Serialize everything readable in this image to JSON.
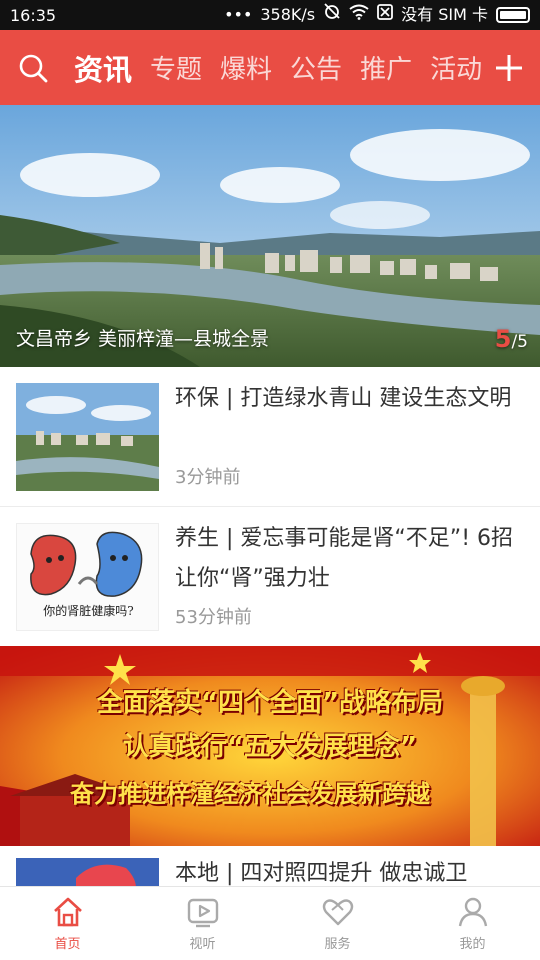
{
  "status_bar": {
    "time": "16:35",
    "dots": "•••",
    "speed": "358K/s",
    "sim": "没有 SIM 卡"
  },
  "nav": {
    "tabs": [
      {
        "label": "资讯",
        "active": true
      },
      {
        "label": "专题",
        "active": false
      },
      {
        "label": "爆料",
        "active": false
      },
      {
        "label": "公告",
        "active": false
      },
      {
        "label": "推广",
        "active": false
      },
      {
        "label": "活动",
        "active": false
      }
    ]
  },
  "hero": {
    "caption": "文昌帝乡 美丽梓潼—县城全景",
    "current_page": "5",
    "total_pages": "/5"
  },
  "news": [
    {
      "title": "环保 | 打造绿水青山 建设生态文明",
      "time": "3分钟前"
    },
    {
      "title": "养生 | 爱忘事可能是肾“不足”! 6招让你“肾”强力壮",
      "time": "53分钟前",
      "thumb_text": "你的肾脏健康吗?"
    },
    {
      "title": "本地 | 四对照四提升 做忠诚卫"
    }
  ],
  "promo": {
    "line1": "全面落实“四个全面”战略布局",
    "line2": "认真践行“五大发展理念”",
    "line3": "奋力推进梓潼经济社会发展新跨越"
  },
  "tabbar": [
    {
      "label": "首页",
      "icon": "home-icon",
      "active": true
    },
    {
      "label": "视听",
      "icon": "video-icon",
      "active": false
    },
    {
      "label": "服务",
      "icon": "heart-icon",
      "active": false
    },
    {
      "label": "我的",
      "icon": "user-icon",
      "active": false
    }
  ],
  "colors": {
    "accent": "#e94d44",
    "text": "#333333",
    "muted": "#999999"
  }
}
